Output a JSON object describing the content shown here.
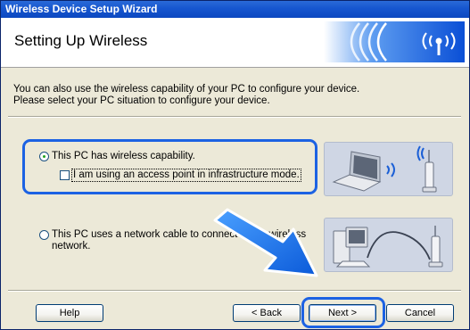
{
  "window": {
    "title": "Wireless Device Setup Wizard"
  },
  "header": {
    "title": "Setting Up Wireless"
  },
  "description": {
    "line1": "You can also use the wireless capability of your PC to configure your device.",
    "line2": "Please select your PC situation to configure your device."
  },
  "options": {
    "wireless": {
      "label": "This PC has wireless capability.",
      "selected": true,
      "sub_checkbox": {
        "label": "I am using an access point in infrastructure mode.",
        "checked": false
      }
    },
    "cable": {
      "label_line1": "This PC uses a network cable to connect to the wireless",
      "label_line2": "network.",
      "selected": false
    }
  },
  "buttons": {
    "help": "Help",
    "back": "< Back",
    "next": "Next >",
    "cancel": "Cancel"
  },
  "colors": {
    "highlight": "#1c62e3",
    "titlebar": "#1656cf",
    "arrow": "#1a73e8"
  },
  "icons": [
    "wireless-signal-icon",
    "laptop-icon",
    "access-point-icon",
    "desktop-pc-icon",
    "network-cable-icon",
    "pointer-arrow-icon"
  ]
}
